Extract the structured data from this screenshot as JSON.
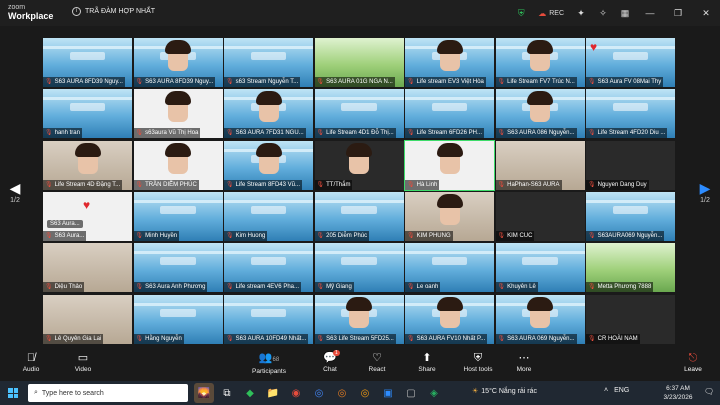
{
  "titlebar": {
    "logo_line1": "zoom",
    "logo_line2": "Workplace",
    "meeting_title": "TRÃ ĐÀM HỢP NHẤT",
    "rec_label": "REC"
  },
  "tiles": [
    {
      "name": "S63 AURA 8FD39 Nguy...",
      "scene": "slide",
      "face": false
    },
    {
      "name": "S63 AURA 8FD39 Nguy...",
      "scene": "slide",
      "face": true
    },
    {
      "name": "s63 Stream Nguyễn T...",
      "scene": "slide",
      "face": false
    },
    {
      "name": "S63 AURA 01G NGA N...",
      "scene": "grass",
      "face": false
    },
    {
      "name": "Life stream EV3 Việt Hòa",
      "scene": "slide",
      "face": true
    },
    {
      "name": "Life Stream FV7 Trúc N...",
      "scene": "slide",
      "face": true
    },
    {
      "name": "S63 Aura FV 08Mai Thy",
      "scene": "slide",
      "face": false,
      "heart": true
    },
    {
      "name": "hanh tran",
      "scene": "slide",
      "face": false
    },
    {
      "name": "s63aura Vũ Thị Hoa",
      "scene": "white",
      "face": true
    },
    {
      "name": "S63 AURA 7FD31 NGU...",
      "scene": "slide",
      "face": true
    },
    {
      "name": "Life Stream 4D1 Đỗ Thị...",
      "scene": "slide",
      "face": false
    },
    {
      "name": "Life Stream 6FD26 PH...",
      "scene": "slide",
      "face": false
    },
    {
      "name": "S63 AURA 086 Nguyễn...",
      "scene": "slide",
      "face": true
    },
    {
      "name": "Life Stream 4FD20 Diu ...",
      "scene": "slide",
      "face": false
    },
    {
      "name": "Life Stream 4D Đặng T...",
      "scene": "room",
      "face": true
    },
    {
      "name": "TRẦN DIỄM PHÚC",
      "scene": "white",
      "face": true
    },
    {
      "name": "Life Stream 8FD43 Vũ...",
      "scene": "slide",
      "face": true
    },
    {
      "name": "TT/Thắm",
      "scene": "dark",
      "face": true
    },
    {
      "name": "Hà Linh",
      "scene": "white",
      "face": true,
      "active": true
    },
    {
      "name": "HaPhan-S63 AURA",
      "scene": "room",
      "face": false
    },
    {
      "name": "Nguyen Dang Duy",
      "scene": "dark",
      "face": false
    },
    {
      "name": "S63 Aura...",
      "scene": "white",
      "face": false,
      "heart": true,
      "avatar_label": "S63 Aura..."
    },
    {
      "name": "Minh Huyền",
      "scene": "slide",
      "face": false
    },
    {
      "name": "Kim Huong",
      "scene": "slide",
      "face": false
    },
    {
      "name": "205 Diễm Phúc",
      "scene": "slide",
      "face": false
    },
    {
      "name": "KIM PHUNG",
      "scene": "room",
      "face": true
    },
    {
      "name": "KIM CUC",
      "scene": "dark",
      "face": false
    },
    {
      "name": "S63AURA069 Nguyễn...",
      "scene": "slide",
      "face": false
    },
    {
      "name": "Diệu Thảo",
      "scene": "room",
      "face": false
    },
    {
      "name": "S63 Aura Anh Phương",
      "scene": "slide",
      "face": false
    },
    {
      "name": "Life stream 4EV6 Pha...",
      "scene": "slide",
      "face": false
    },
    {
      "name": "Mỹ Giang",
      "scene": "slide",
      "face": false
    },
    {
      "name": "Le oanh",
      "scene": "slide",
      "face": false
    },
    {
      "name": "Khuyên Lê",
      "scene": "slide",
      "face": false
    },
    {
      "name": "Metta Phương 7888",
      "scene": "grass",
      "face": false
    },
    {
      "name": "Lê Quyên Gia Lai",
      "scene": "room",
      "face": false
    },
    {
      "name": "Hằng Nguyễn",
      "scene": "slide",
      "face": false
    },
    {
      "name": "S63 AURA 10FD49 Nhất...",
      "scene": "slide",
      "face": false
    },
    {
      "name": "S63 Life Stream 5FD25...",
      "scene": "slide",
      "face": true
    },
    {
      "name": "S63 AURA FV10 Nhất P...",
      "scene": "slide",
      "face": true
    },
    {
      "name": "S63 AURA 069 Nguyễn...",
      "scene": "slide",
      "face": true
    },
    {
      "name": "CR HOÀI NAM",
      "scene": "dark",
      "face": false
    }
  ],
  "pager": {
    "left_label": "1/2",
    "right_label": "1/2"
  },
  "toolbar": {
    "audio": "Audio",
    "video": "Video",
    "participants": "Participants",
    "participants_count": "68",
    "chat": "Chat",
    "chat_badge": "1",
    "react": "React",
    "share": "Share",
    "host_tools": "Host tools",
    "more": "More",
    "leave": "Leave"
  },
  "taskbar": {
    "search_placeholder": "Type here to search",
    "weather": "15°C  Nắng rải rác",
    "lang": "ENG",
    "time": "6:37 AM",
    "date": "3/23/2026",
    "notif_count": "5"
  },
  "colors": {
    "accent": "#2d8cff",
    "leave": "#e74c3c",
    "active_border": "#3ddc6a"
  }
}
